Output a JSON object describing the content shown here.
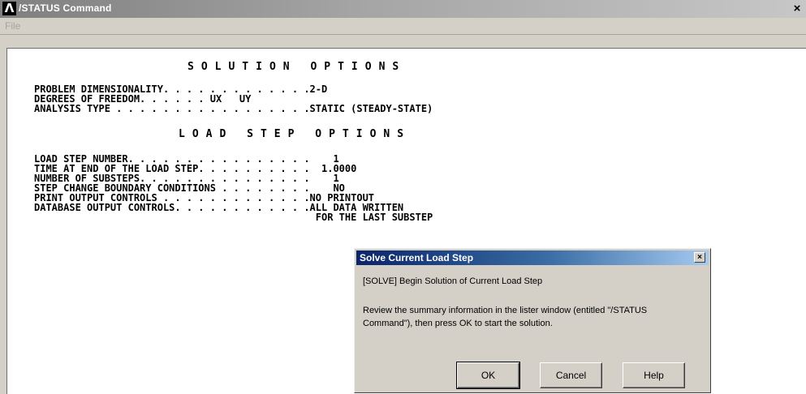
{
  "window": {
    "title": "/STATUS Command",
    "logo": "Λ",
    "close_glyph": "×",
    "menu": {
      "file_label": "File"
    }
  },
  "solution_options": {
    "heading": "SOLUTION OPTIONS",
    "lines": [
      "PROBLEM DIMENSIONALITY. . . . . . . . . . . . .2-D",
      "DEGREES OF FREEDOM. . . . . . UX   UY",
      "ANALYSIS TYPE . . . . . . . . . . . . . . . . .STATIC (STEADY-STATE)"
    ]
  },
  "load_step_options": {
    "heading": "LOAD STEP OPTIONS",
    "lines": [
      "LOAD STEP NUMBER. . . . . . . . . . . . . . . .    1",
      "TIME AT END OF THE LOAD STEP. . . . . . . . . .  1.0000",
      "NUMBER OF SUBSTEPS. . . . . . . . . . . . . . .    1",
      "STEP CHANGE BOUNDARY CONDITIONS . . . . . . . .    NO",
      "PRINT OUTPUT CONTROLS . . . . . . . . . . . . .NO PRINTOUT",
      "DATABASE OUTPUT CONTROLS. . . . . . . . . . . .ALL DATA WRITTEN",
      "                                                FOR THE LAST SUBSTEP"
    ]
  },
  "dialog": {
    "title": "Solve Current Load Step",
    "close_glyph": "×",
    "line1": "[SOLVE] Begin Solution of Current Load Step",
    "line2a": "Review the summary information in the lister window (entitled  \"/STATUS",
    "line2b": "Command\"), then press OK to start the solution.",
    "ok_label": "OK",
    "cancel_label": "Cancel",
    "help_label": "Help"
  }
}
